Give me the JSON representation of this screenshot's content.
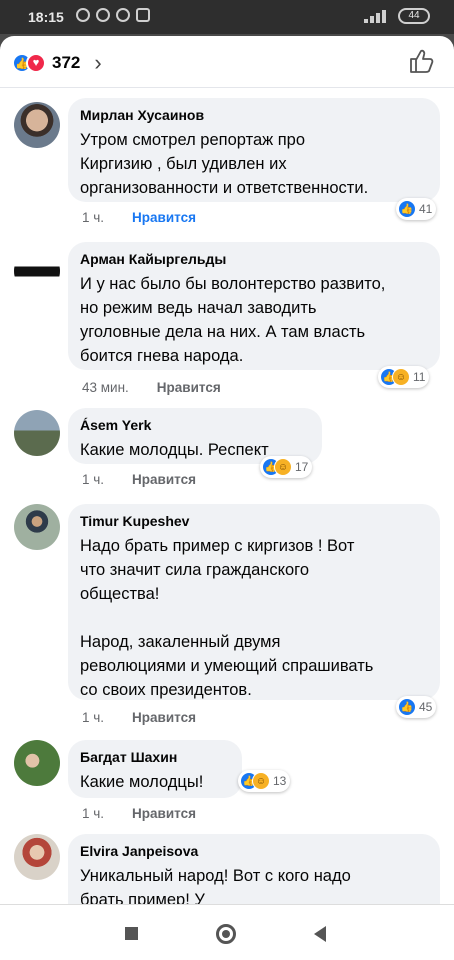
{
  "status_bar": {
    "time": "18:15",
    "battery": "44",
    "icons": [
      "alarm-icon",
      "mail-icon",
      "telegram-icon",
      "instagram-icon",
      "signal-icon",
      "battery-icon"
    ]
  },
  "header": {
    "reaction_count": "372",
    "reaction_icons": [
      "like-icon",
      "love-icon"
    ],
    "chevron": "›"
  },
  "comments": [
    {
      "author": "Мирлан Хусаинов",
      "text": "Утром смотрел репортаж про\nКиргизию , был удивлен  их\nорганизованности и ответственности.",
      "time": "1 ч.",
      "like_label": "Нравится",
      "reaction_count": "41",
      "reactions": [
        "like"
      ]
    },
    {
      "author": "Арман Кайыргельды",
      "text": "И у нас было бы волонтерство развито,\nно режим ведь начал заводить\nуголовные дела на них. А там власть\nбоится гнева народа.",
      "time": "43 мин.",
      "like_label": "Нравится",
      "reaction_count": "11",
      "reactions": [
        "like",
        "haha"
      ]
    },
    {
      "author": "Ásem Yerk",
      "text": "Какие молодцы. Респект",
      "time": "1 ч.",
      "like_label": "Нравится",
      "reaction_count": "17",
      "reactions": [
        "like",
        "haha"
      ]
    },
    {
      "author": "Timur Kupeshev",
      "text": "Надо брать пример с киргизов ! Вот\nчто значит сила гражданского\nобщества!\n\nНарод, закаленный двумя\nреволюциями и умеющий спрашивать\nсо своих президентов.",
      "time": "1 ч.",
      "like_label": "Нравится",
      "reaction_count": "45",
      "reactions": [
        "like"
      ]
    },
    {
      "author": "Багдат Шахин",
      "text": "Какие молодцы!",
      "time": "1 ч.",
      "like_label": "Нравится",
      "reaction_count": "13",
      "reactions": [
        "like",
        "haha"
      ]
    },
    {
      "author": "Elvira  Janpeisova",
      "text": "Уникальный народ! Вот с кого надо\nбрать пример! У",
      "time": "",
      "like_label": "",
      "reaction_count": "",
      "reactions": []
    }
  ],
  "colors": {
    "accent": "#1877f2",
    "bubble": "#f0f2f5",
    "love": "#f0284a",
    "haha": "#f7b125"
  }
}
